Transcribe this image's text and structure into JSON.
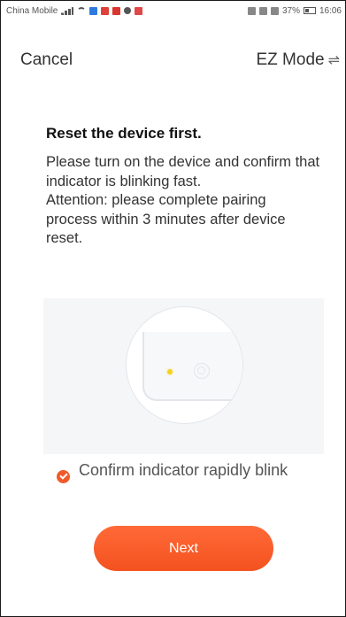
{
  "status_bar": {
    "carrier": "China Mobile",
    "battery": "37%",
    "time": "16:06"
  },
  "header": {
    "cancel_label": "Cancel",
    "mode_label": "EZ Mode",
    "mode_icon": "⇌"
  },
  "content": {
    "title": "Reset the device first.",
    "paragraph_1": "Please turn on the device and confirm that indicator is blinking fast.",
    "paragraph_2": "Attention: please complete pairing process within 3 minutes after device reset."
  },
  "confirm": {
    "label": "Confirm indicator rapidly blink",
    "checked": true
  },
  "next_button": {
    "label": "Next"
  },
  "colors": {
    "accent": "#f4521f",
    "indicator": "#f2d31b"
  }
}
